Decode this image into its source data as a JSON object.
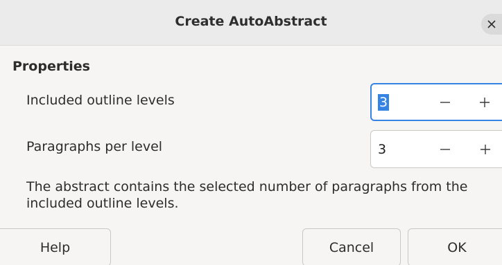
{
  "dialog": {
    "title": "Create AutoAbstract",
    "close_icon": "close-icon"
  },
  "properties": {
    "heading": "Properties",
    "outline_levels": {
      "label": "Included outline levels",
      "value": "3",
      "focused": true,
      "selected": true
    },
    "paragraphs_per_level": {
      "label": "Paragraphs per level",
      "value": "3"
    },
    "spin_icons": {
      "decrement": "minus-icon",
      "increment": "plus-icon"
    },
    "description": "The abstract contains the selected number of paragraphs from the included outline levels."
  },
  "buttons": {
    "help": "Help",
    "cancel": "Cancel",
    "ok": "OK"
  },
  "colors": {
    "accent": "#3584e4",
    "window_bg": "#f6f5f4",
    "titlebar_bg": "#ebebeb"
  }
}
